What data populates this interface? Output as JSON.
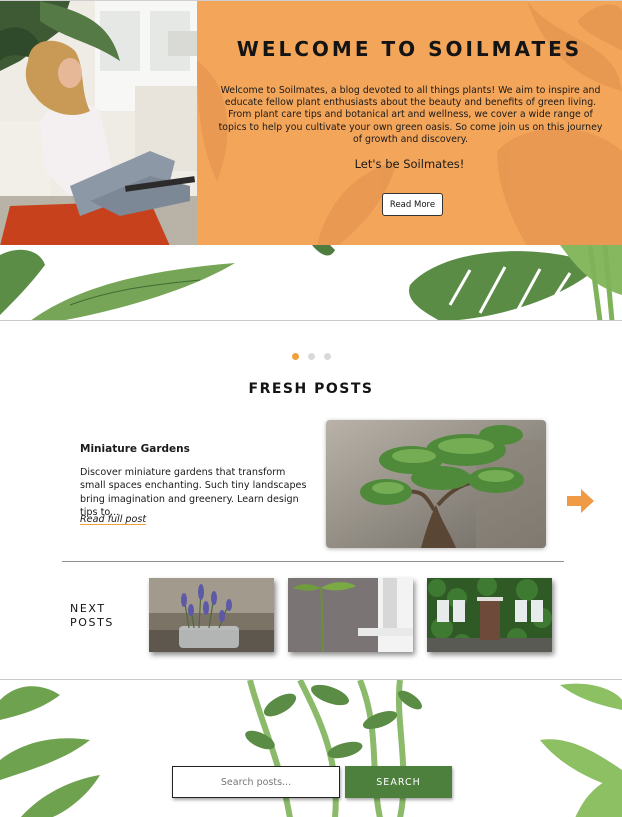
{
  "hero": {
    "title": "WELCOME TO SOILMATES",
    "description": "Welcome to Soilmates, a blog devoted to all things plants! We aim to inspire and educate fellow plant enthusiasts about the beauty and benefits of green living. From plant care tips and botanical art and wellness, we cover a wide range of topics to help you cultivate your own green oasis. So come join us on this journey of growth and discovery.",
    "tagline": "Let's be Soilmates!",
    "button_label": "Read More",
    "accent_color": "#f3a55a"
  },
  "carousel": {
    "dot_count": 3,
    "active_index": 0,
    "active_color": "#f0a238"
  },
  "fresh_posts": {
    "heading": "FRESH POSTS",
    "featured": {
      "title": "Miniature Gardens",
      "excerpt": "Discover miniature gardens that transform small spaces enchanting. Such tiny landscapes bring imagination and greenery. Learn design tips to...",
      "link_label": "Read full post"
    },
    "next_arrow_icon": "arrow-right-icon"
  },
  "next_posts": {
    "label_line1": "NEXT",
    "label_line2": "POSTS",
    "thumbnails": [
      "lavender-jar",
      "sprout-window",
      "ivy-doorway"
    ]
  },
  "search": {
    "placeholder": "Search posts...",
    "button_label": "SEARCH",
    "button_color": "#4d7f3d"
  }
}
